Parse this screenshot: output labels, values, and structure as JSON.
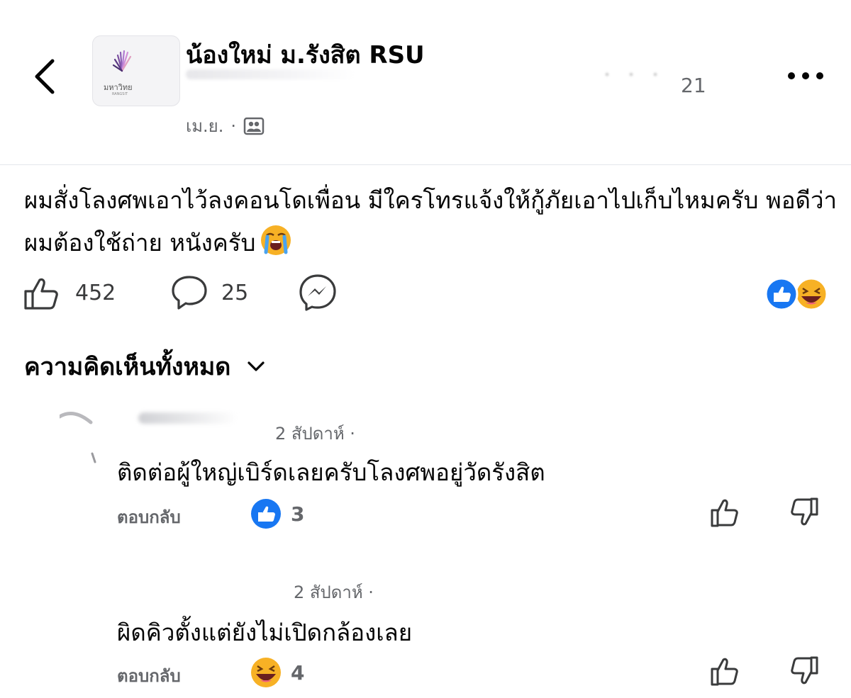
{
  "header": {
    "group_name": "น้องใหม่ ม.รังสิต RSU",
    "member_count": "21",
    "post_date": "เม.ย.",
    "separator": "·",
    "avatar_logo_text": "มหาวิทย",
    "avatar_logo_sub": "RANGSIT"
  },
  "post": {
    "text": "ผมสั่งโลงศพเอาไว้ลงคอนโดเพื่อน มีใครโทรแจ้งให้กู้ภัยเอาไปเก็บไหมครับ พอดีว่าผมต้องใช้ถ่าย หนังครับ",
    "like_count": "452",
    "comment_count": "25",
    "reactions": [
      "like-icon",
      "haha-icon"
    ]
  },
  "comments_section": {
    "title": "ความคิดเห็นทั้งหมด"
  },
  "comments": [
    {
      "time": "2 สัปดาห์ ·",
      "text": "ติดต่อผู้ใหญ่เบิร์ดเลยครับโลงศพอยู่วัดรังสิต",
      "reply_label": "ตอบกลับ",
      "reaction": "like-icon",
      "reaction_count": "3"
    },
    {
      "time": "2 สัปดาห์ ·",
      "text": "ผิดคิวตั้งแต่ยังไม่เปิดกล้องเลย",
      "reply_label": "ตอบกลับ",
      "reaction": "haha-icon",
      "reaction_count": "4"
    }
  ],
  "colors": {
    "facebook_blue": "#1877f2",
    "secondary_text": "#65676b",
    "emoji_yellow": "#f7b125"
  }
}
